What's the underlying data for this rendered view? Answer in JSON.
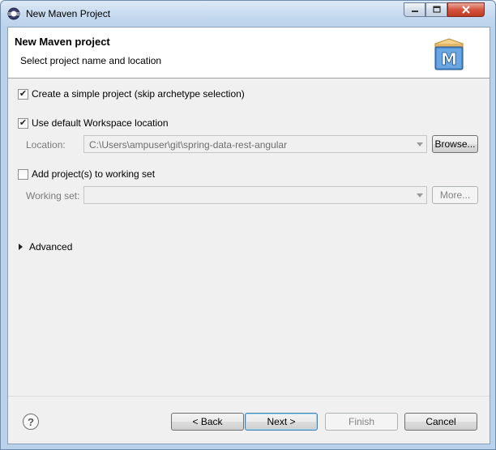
{
  "window": {
    "title": "New Maven Project",
    "controls": {
      "minimize": "minimize-icon",
      "maximize": "maximize-icon",
      "close": "close-icon"
    }
  },
  "header": {
    "title": "New Maven project",
    "subtitle": "Select project name and location",
    "logo_letter": "M"
  },
  "options": {
    "simple_project": {
      "label": "Create a simple project (skip archetype selection)",
      "checked": true
    },
    "default_location": {
      "label": "Use default Workspace location",
      "checked": true
    },
    "location_label": "Location:",
    "location_value": "C:\\Users\\ampuser\\git\\spring-data-rest-angular",
    "browse_label": "Browse...",
    "add_working_set": {
      "label": "Add project(s) to working set",
      "checked": false
    },
    "working_set_label": "Working set:",
    "working_set_value": "",
    "more_label": "More...",
    "advanced_label": "Advanced"
  },
  "footer": {
    "help_icon": "help-icon",
    "back_label": "< Back",
    "next_label": "Next >",
    "finish_label": "Finish",
    "cancel_label": "Cancel"
  },
  "colors": {
    "titlebar": "#c4d8ee",
    "close_button": "#c23b22",
    "default_button_border": "#3c7fb1",
    "maven_logo_blue": "#2f6fb3",
    "maven_logo_box": "#e3b765"
  }
}
